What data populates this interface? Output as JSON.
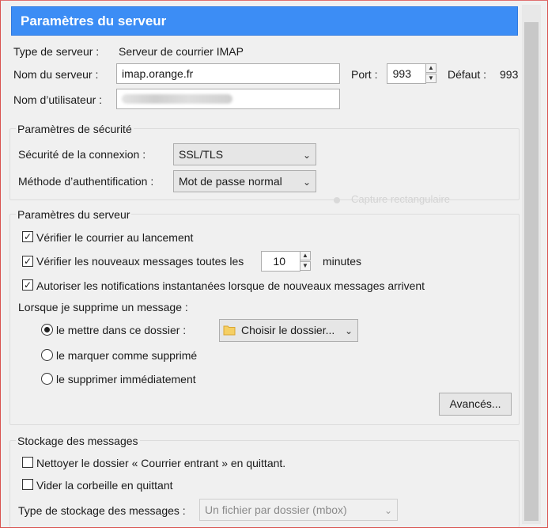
{
  "header": {
    "title": "Paramètres du serveur"
  },
  "server": {
    "type_label": "Type de serveur :",
    "type_value": "Serveur de courrier IMAP",
    "name_label": "Nom du serveur :",
    "name_value": "imap.orange.fr",
    "port_label": "Port :",
    "port_value": "993",
    "default_label": "Défaut :",
    "default_value": "993",
    "user_label": "Nom d’utilisateur :"
  },
  "security": {
    "title": "Paramètres de sécurité",
    "connection_label": "Sécurité de la connexion :",
    "connection_value": "SSL/TLS",
    "auth_label": "Méthode d’authentification :",
    "auth_value": "Mot de passe normal",
    "ghost_text": "Capture rectangulaire"
  },
  "settings": {
    "title": "Paramètres du serveur",
    "check_startup": "Vérifier le courrier au lancement",
    "check_every": "Vérifier les nouveaux messages toutes les",
    "check_every_value": "10",
    "minutes": "minutes",
    "push_notif": "Autoriser les notifications instantanées lorsque de nouveaux messages arrivent",
    "on_delete": "Lorsque je supprime un message :",
    "move_to_folder": "le mettre dans ce dossier :",
    "choose_folder": "Choisir le dossier...",
    "mark_deleted": "le marquer comme supprimé",
    "delete_now": "le supprimer immédiatement",
    "advanced": "Avancés..."
  },
  "storage": {
    "title": "Stockage des messages",
    "clean_inbox": "Nettoyer le dossier « Courrier entrant » en quittant.",
    "empty_trash": "Vider la corbeille en quittant",
    "type_label": "Type de stockage des messages :",
    "type_value": "Un fichier par dossier (mbox)"
  },
  "colors": {
    "header_bg": "#3c8df5",
    "window_bg": "#f0f0f0"
  }
}
